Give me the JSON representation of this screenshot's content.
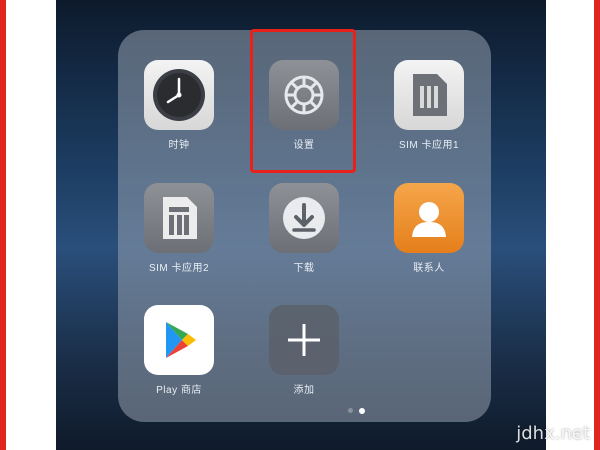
{
  "folder": {
    "apps": [
      {
        "name": "clock",
        "label": "时钟",
        "icon": "clock-icon"
      },
      {
        "name": "settings",
        "label": "设置",
        "icon": "gear-icon"
      },
      {
        "name": "sim-card-1",
        "label": "SIM 卡应用1",
        "icon": "sim-card-icon"
      },
      {
        "name": "sim-card-2",
        "label": "SIM 卡应用2",
        "icon": "sim-card-icon"
      },
      {
        "name": "downloads",
        "label": "下载",
        "icon": "download-icon"
      },
      {
        "name": "contacts",
        "label": "联系人",
        "icon": "contact-icon"
      },
      {
        "name": "play-store",
        "label": "Play 商店",
        "icon": "play-store-icon"
      },
      {
        "name": "add",
        "label": "添加",
        "icon": "plus-icon"
      }
    ],
    "page_indicator": {
      "pages": 2,
      "current": 2
    }
  },
  "highlight_target": "settings",
  "watermark": "jdhx.net",
  "colors": {
    "frame_border": "#e0271f",
    "highlight_border": "#e8211a",
    "contacts_orange": "#f0922f"
  }
}
